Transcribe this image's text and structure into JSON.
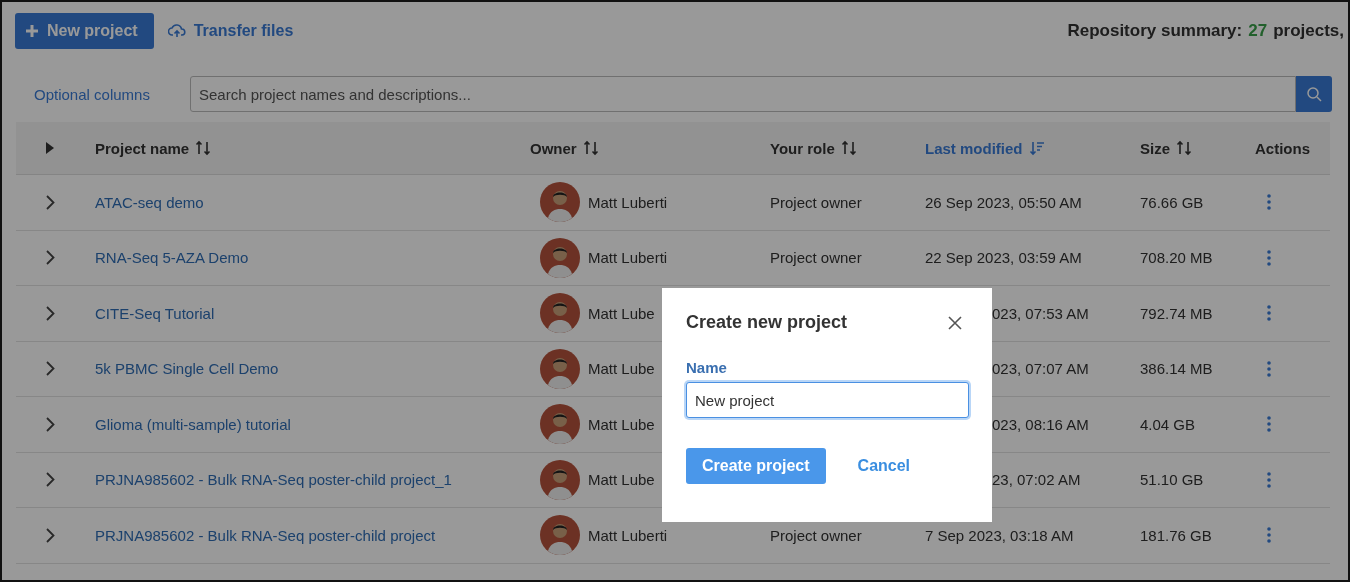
{
  "toolbar": {
    "new_button": "New project",
    "transfer_link": "Transfer files"
  },
  "summary": {
    "label": "Repository summary:",
    "count": "27",
    "unit": "projects,"
  },
  "filters": {
    "optional_columns": "Optional columns",
    "search": {
      "placeholder": "Search project names and descriptions..."
    }
  },
  "table": {
    "columns": [
      {
        "label": "Project name",
        "sortable": true,
        "sorted": false
      },
      {
        "label": "Owner",
        "sortable": true,
        "sorted": false
      },
      {
        "label": "Your role",
        "sortable": true,
        "sorted": false
      },
      {
        "label": "Last modified",
        "sortable": true,
        "sorted": true
      },
      {
        "label": "Size",
        "sortable": true,
        "sorted": false
      },
      {
        "label": "Actions",
        "sortable": false,
        "sorted": false
      }
    ],
    "rows": [
      {
        "name": "ATAC-seq demo",
        "owner": "Matt Luberti",
        "role": "Project owner",
        "modified": "26 Sep 2023, 05:50 AM",
        "size": "76.66 GB"
      },
      {
        "name": "RNA-Seq 5-AZA Demo",
        "owner": "Matt Luberti",
        "role": "Project owner",
        "modified": "22 Sep 2023, 03:59 AM",
        "size": "708.20 MB"
      },
      {
        "name": "CITE-Seq Tutorial",
        "owner": "Matt Lube",
        "modified": "023, 07:53 AM",
        "size": "792.74 MB"
      },
      {
        "name": "5k PBMC Single Cell Demo",
        "owner": "Matt Lube",
        "modified": "023, 07:07 AM",
        "size": "386.14 MB"
      },
      {
        "name": "Glioma (multi-sample) tutorial",
        "owner": "Matt Lube",
        "modified": "023, 08:16 AM",
        "size": "4.04 GB"
      },
      {
        "name": "PRJNA985602 - Bulk RNA-Seq poster-child project_1",
        "owner": "Matt Lube",
        "modified": "23, 07:02 AM",
        "size": "51.10 GB"
      },
      {
        "name": "PRJNA985602 - Bulk RNA-Seq poster-child project",
        "owner": "Matt Luberti",
        "role": "Project owner",
        "modified": "7 Sep 2023, 03:18 AM",
        "size": "181.76 GB"
      }
    ]
  },
  "dialog": {
    "title": "Create new project",
    "field": {
      "label": "Name",
      "value": "New project",
      "focused": true
    },
    "primary_button": "Create project",
    "cancel_button": "Cancel"
  }
}
